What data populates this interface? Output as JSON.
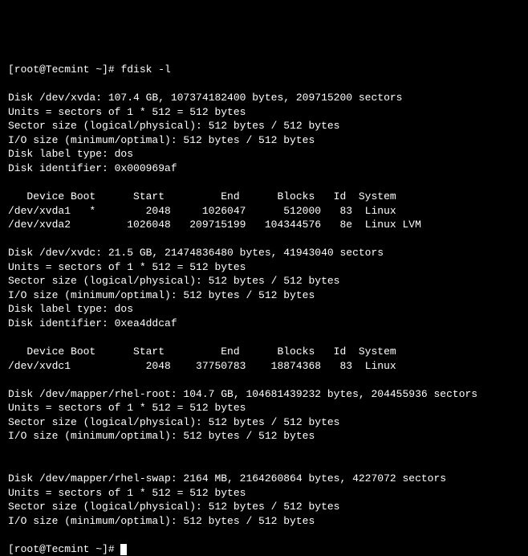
{
  "prompt1": "[root@Tecmint ~]# ",
  "command": "fdisk -l",
  "disks": [
    {
      "header": "Disk /dev/xvda: 107.4 GB, 107374182400 bytes, 209715200 sectors",
      "units": "Units = sectors of 1 * 512 = 512 bytes",
      "sector": "Sector size (logical/physical): 512 bytes / 512 bytes",
      "io": "I/O size (minimum/optimal): 512 bytes / 512 bytes",
      "label": "Disk label type: dos",
      "id": "Disk identifier: 0x000969af",
      "colhead": "   Device Boot      Start         End      Blocks   Id  System",
      "rows": [
        "/dev/xvda1   *        2048     1026047      512000   83  Linux",
        "/dev/xvda2         1026048   209715199   104344576   8e  Linux LVM"
      ]
    },
    {
      "header": "Disk /dev/xvdc: 21.5 GB, 21474836480 bytes, 41943040 sectors",
      "units": "Units = sectors of 1 * 512 = 512 bytes",
      "sector": "Sector size (logical/physical): 512 bytes / 512 bytes",
      "io": "I/O size (minimum/optimal): 512 bytes / 512 bytes",
      "label": "Disk label type: dos",
      "id": "Disk identifier: 0xea4ddcaf",
      "colhead": "   Device Boot      Start         End      Blocks   Id  System",
      "rows": [
        "/dev/xvdc1            2048    37750783    18874368   83  Linux"
      ]
    },
    {
      "header": "Disk /dev/mapper/rhel-root: 104.7 GB, 104681439232 bytes, 204455936 sectors",
      "units": "Units = sectors of 1 * 512 = 512 bytes",
      "sector": "Sector size (logical/physical): 512 bytes / 512 bytes",
      "io": "I/O size (minimum/optimal): 512 bytes / 512 bytes",
      "label": "",
      "id": "",
      "colhead": "",
      "rows": []
    },
    {
      "header": "Disk /dev/mapper/rhel-swap: 2164 MB, 2164260864 bytes, 4227072 sectors",
      "units": "Units = sectors of 1 * 512 = 512 bytes",
      "sector": "Sector size (logical/physical): 512 bytes / 512 bytes",
      "io": "I/O size (minimum/optimal): 512 bytes / 512 bytes",
      "label": "",
      "id": "",
      "colhead": "",
      "rows": []
    }
  ],
  "prompt2": "[root@Tecmint ~]# "
}
